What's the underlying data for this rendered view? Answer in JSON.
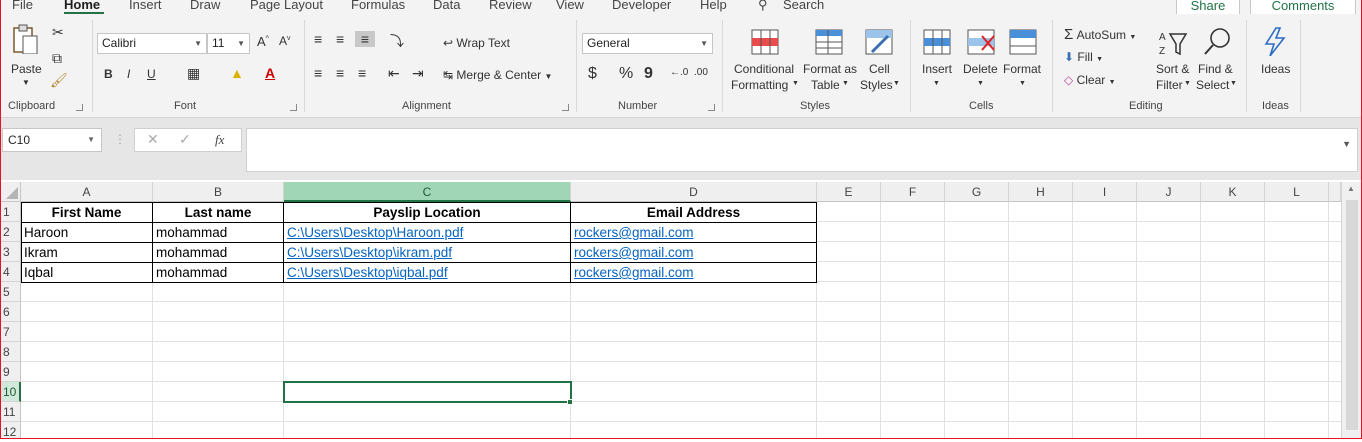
{
  "tabs": [
    "File",
    "Home",
    "Insert",
    "Draw",
    "Page Layout",
    "Formulas",
    "Data",
    "Review",
    "View",
    "Developer",
    "Help"
  ],
  "search_label": "Search",
  "share_label": "Share",
  "comments_label": "Comments",
  "ribbon": {
    "clipboard": {
      "paste": "Paste",
      "group": "Clipboard"
    },
    "font": {
      "name": "Calibri",
      "size": "11",
      "group": "Font",
      "bold": "B",
      "italic": "I",
      "underline": "U"
    },
    "alignment": {
      "wrap": "Wrap Text",
      "merge": "Merge & Center",
      "group": "Alignment"
    },
    "number": {
      "format": "General",
      "currency": "$",
      "percent": "%",
      "comma": "9",
      "group": "Number"
    },
    "styles": {
      "cond1": "Conditional",
      "cond2": "Formatting",
      "table1": "Format as",
      "table2": "Table",
      "cell1": "Cell",
      "cell2": "Styles",
      "group": "Styles"
    },
    "cells": {
      "insert": "Insert",
      "delete": "Delete",
      "format": "Format",
      "group": "Cells"
    },
    "editing": {
      "autosum": "AutoSum",
      "fill": "Fill",
      "clear": "Clear",
      "sort1": "Sort &",
      "sort2": "Filter",
      "find1": "Find &",
      "find2": "Select",
      "group": "Editing"
    },
    "ideas": {
      "label": "Ideas",
      "group": "Ideas"
    }
  },
  "name_box": "C10",
  "fx": "fx",
  "columns": [
    "A",
    "B",
    "C",
    "D",
    "E",
    "F",
    "G",
    "H",
    "I",
    "J",
    "K",
    "L"
  ],
  "rows": [
    "1",
    "2",
    "3",
    "4",
    "5",
    "6",
    "7",
    "8",
    "9",
    "10",
    "11",
    "12"
  ],
  "sheet": {
    "headers": [
      "First Name",
      "Last name",
      "Payslip Location",
      "Email Address"
    ],
    "data": [
      [
        "Haroon",
        "mohammad",
        "C:\\Users\\Desktop\\Haroon.pdf",
        "rockers@gmail.com"
      ],
      [
        "Ikram",
        "mohammad",
        "C:\\Users\\Desktop\\ikram.pdf",
        "rockers@gmail.com"
      ],
      [
        "Iqbal",
        "mohammad",
        "C:\\Users\\Desktop\\iqbal.pdf",
        "rockers@gmail.com"
      ]
    ]
  },
  "colors": {
    "accent": "#217346",
    "link": "#0563c1",
    "selected_col": "#a0d5b5"
  }
}
